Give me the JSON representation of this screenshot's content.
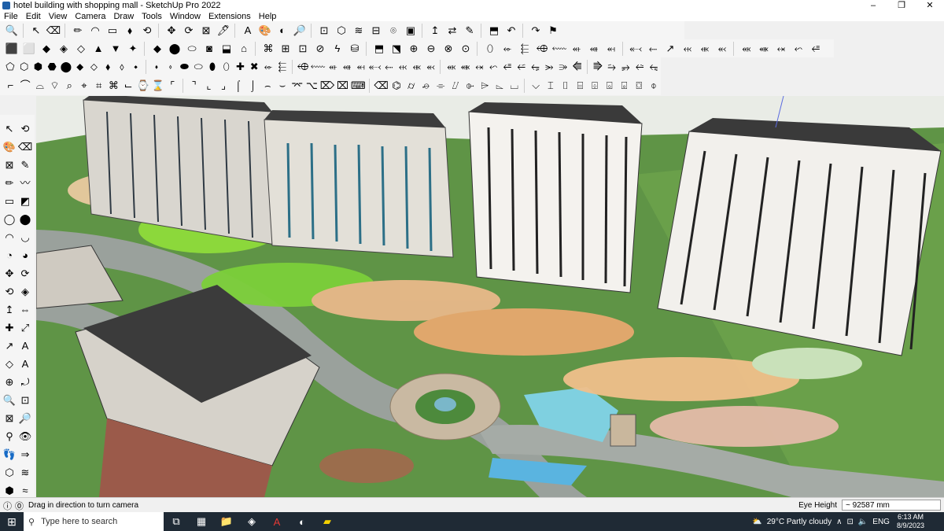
{
  "window": {
    "title": "hotel building with shopping mall - SketchUp Pro 2022",
    "minimize": "–",
    "maximize": "❐",
    "close": "✕"
  },
  "menu": [
    "File",
    "Edit",
    "View",
    "Camera",
    "Draw",
    "Tools",
    "Window",
    "Extensions",
    "Help"
  ],
  "toolbars": {
    "row1": [
      "🔍",
      "↖",
      "⌫",
      "✏",
      "◠",
      "▭",
      "⬧",
      "⟲",
      "✥",
      "⟳",
      "⊠",
      "🖊",
      "A",
      "🎨",
      "◐",
      "🔎",
      "⊡",
      "⬡",
      "≋",
      "⊟",
      "⌾",
      "▣",
      "↥",
      "⇄",
      "✎",
      "⬒",
      "↶",
      "↷",
      "⚑"
    ],
    "row2": [
      "⬛",
      "⬜",
      "◆",
      "◈",
      "◇",
      "▲",
      "▼",
      "✦",
      "◆",
      "⬤",
      "⬭",
      "◙",
      "⬓",
      "⌂",
      "⌘",
      "⊞",
      "⊡",
      "⊘",
      "ϟ",
      "⛁",
      "⬒",
      "⬔",
      "⊕",
      "⊖",
      "⊗",
      "⊙",
      "⬯",
      "⬰",
      "⬱",
      "⬲",
      "⬳",
      "⬴",
      "⬵",
      "⬶",
      "⬷",
      "⬸",
      "↗",
      "⬹",
      "⬺",
      "⬻",
      "⬼",
      "⬽",
      "⬾",
      "⬿",
      "⭀"
    ],
    "row3": [
      "⬠",
      "⬡",
      "⬢",
      "⬣",
      "⬤",
      "⬥",
      "⬦",
      "⬧",
      "⬨",
      "⬩",
      "⬪",
      "⬫",
      "⬬",
      "⬭",
      "⬮",
      "⬯",
      "✚",
      "✖",
      "⬰",
      "⬱",
      "⬲",
      "⬳",
      "⬴",
      "⬵",
      "⬶",
      "⬷",
      "⬸",
      "⬹",
      "⬺",
      "⬻",
      "⬼",
      "⬽",
      "⬾",
      "⬿",
      "⭀",
      "⭁",
      "⭂",
      "⭃",
      "⭄",
      "⭅",
      "⭆",
      "⭇",
      "⭈",
      "⭉",
      "⭊"
    ],
    "row4": [
      "⌐",
      "⌒",
      "⌓",
      "⌔",
      "⌕",
      "⌖",
      "⌗",
      "⌘",
      "⌙",
      "⌚",
      "⌛",
      "⌜",
      "⌝",
      "⌞",
      "⌟",
      "⌠",
      "⌡",
      "⌢",
      "⌣",
      "⌤",
      "⌥",
      "⌦",
      "⌧",
      "⌨",
      "⌫",
      "⌬",
      "⌭",
      "⌮",
      "⌯",
      "⌰",
      "⌱",
      "⌲",
      "⌳",
      "⌴",
      "⌵",
      "⌶",
      "⌷",
      "⌸",
      "⌹",
      "⌺",
      "⌻",
      "⌼",
      "⌽"
    ]
  },
  "left_tools": [
    "↖",
    "⟲",
    "🎨",
    "⌫",
    "⊠",
    "✎",
    "✏",
    "〰",
    "▭",
    "◩",
    "◯",
    "⬤",
    "◠",
    "◡",
    "◔",
    "◕",
    "✥",
    "⟳",
    "⟲",
    "◈",
    "↥",
    "⇔",
    "✚",
    "⤢",
    "↗",
    "A",
    "◇",
    "A",
    "⊕",
    "⤾",
    "🔍",
    "⊡",
    "⊠",
    "🔎",
    "⚲",
    "👁",
    "👣",
    "⇒",
    "⬡",
    "≋",
    "⬢",
    "≈"
  ],
  "status": {
    "hint": "Drag in direction to turn camera",
    "vcb_label": "Eye Height",
    "vcb_value": "~ 92587 mm"
  },
  "taskbar": {
    "search_placeholder": "Type here to search",
    "weather": "29°C  Partly cloudy",
    "lang": "ENG",
    "time": "6:13 AM",
    "date": "8/9/2023"
  },
  "colors": {
    "sky": "#e9ece6",
    "grass": "#5b8f3e",
    "road": "#9aa19c",
    "roof": "#3b3b3b"
  }
}
